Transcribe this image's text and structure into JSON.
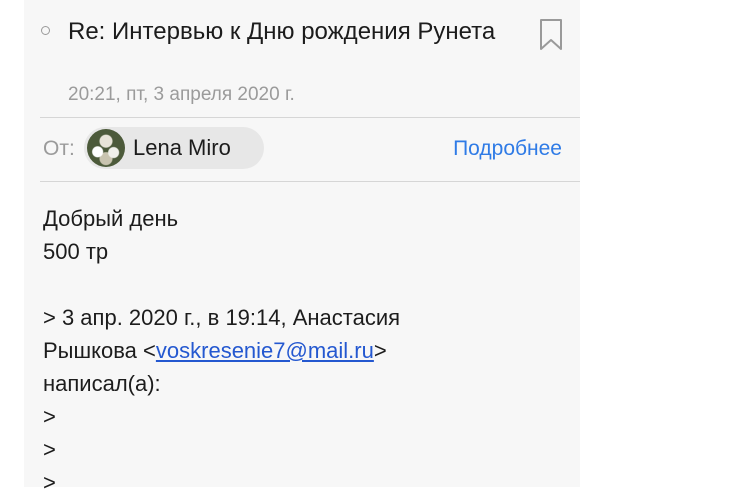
{
  "message": {
    "subject": "Re: Интервью к Дню рождения Рунета",
    "date": "20:21, пт, 3 апреля 2020 г.",
    "from_label": "От:",
    "sender_name": "Lena Miro",
    "details_label": "Подробнее"
  },
  "body": {
    "greeting": "Добрый день",
    "price": "500 тр",
    "quote_header_line1": "> 3 апр. 2020 г., в 19:14, Анастасия",
    "quote_name_prefix": "Рышкова <",
    "quote_email": "voskresenie7@mail.ru",
    "quote_name_suffix": ">",
    "quote_wrote": "написал(а):",
    "quote_markers": [
      ">",
      ">",
      ">"
    ]
  },
  "icons": {
    "unread": "unread-circle-icon",
    "bookmark": "bookmark-icon"
  },
  "colors": {
    "link": "#2f7be6",
    "email_link": "#2458d0",
    "secondary_text": "#9b9b9b"
  }
}
